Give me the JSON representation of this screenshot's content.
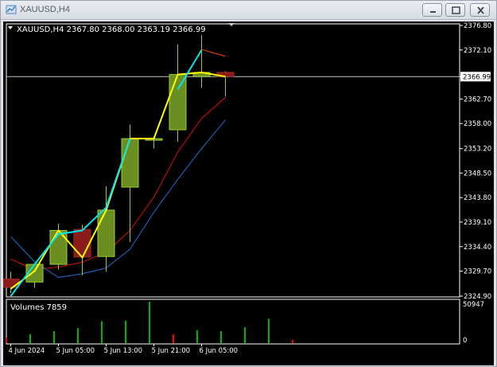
{
  "window": {
    "title": "XAUUSD,H4"
  },
  "chart_data": {
    "type": "candlestick",
    "symbol": "XAUUSD",
    "timeframe": "H4",
    "header": "XAUUSD,H4  2367.80 2368.00 2363.19 2366.99",
    "current_price": 2366.99,
    "current_price_label": "2366.99",
    "ylim": [
      2324.9,
      2376.8
    ],
    "price_ticks": [
      "2376.80",
      "2372.10",
      "2366.99",
      "2362.70",
      "2358.00",
      "2353.20",
      "2348.50",
      "2343.80",
      "2339.10",
      "2334.40",
      "2329.70",
      "2324.90"
    ],
    "time_labels": [
      "4 Jun 2024",
      "5 Jun 05:00",
      "5 Jun 13:00",
      "5 Jun 21:00",
      "6 Jun 05:00"
    ],
    "time_label_indices": [
      0,
      2,
      4,
      6,
      8
    ],
    "candles": [
      {
        "o": 2328.2,
        "h": 2329.6,
        "l": 2325.5,
        "c": 2326.6
      },
      {
        "o": 2327.6,
        "h": 2330.8,
        "l": 2326.5,
        "c": 2331.0
      },
      {
        "o": 2331.0,
        "h": 2338.8,
        "l": 2330.0,
        "c": 2337.5
      },
      {
        "o": 2337.7,
        "h": 2338.6,
        "l": 2328.9,
        "c": 2332.4
      },
      {
        "o": 2332.5,
        "h": 2346.0,
        "l": 2329.6,
        "c": 2341.4
      },
      {
        "o": 2345.8,
        "h": 2357.8,
        "l": 2335.3,
        "c": 2355.1
      },
      {
        "o": 2355.0,
        "h": 2355.5,
        "l": 2353.2,
        "c": 2355.1
      },
      {
        "o": 2356.8,
        "h": 2373.2,
        "l": 2354.5,
        "c": 2367.4
      },
      {
        "o": 2367.0,
        "h": 2375.0,
        "l": 2364.8,
        "c": 2367.8
      },
      {
        "o": 2367.8,
        "h": 2368.0,
        "l": 2363.19,
        "c": 2366.99
      }
    ],
    "series": [
      {
        "color": "#ffff00",
        "values": [
          2326.3,
          2329.7,
          2337.5,
          2332.3,
          2341.4,
          2355.1,
          2355.1,
          2367.4,
          2367.8,
          2367.0
        ]
      },
      {
        "color": "#00e5ee",
        "values": [
          2324.9,
          2331.0,
          2336.8,
          2337.5,
          2341.9,
          2355.1,
          null,
          2364.5,
          2372.1,
          null
        ]
      },
      {
        "color": "#ff4500",
        "values": [
          null,
          null,
          null,
          null,
          null,
          null,
          null,
          null,
          2372.2,
          2370.9
        ]
      },
      {
        "color": "#e01010",
        "values": [
          2332.0,
          2330.0,
          2330.5,
          2331.4,
          2333.3,
          2337.5,
          2343.9,
          2352.5,
          2359.0,
          2363.0
        ]
      },
      {
        "color": "#1e6ed8",
        "values": [
          2336.3,
          2331.5,
          2328.5,
          2329.2,
          2330.3,
          2333.9,
          2341.0,
          2347.3,
          2353.2,
          2358.7
        ]
      }
    ],
    "volumes": {
      "label": "Volumes 7859",
      "max_label": "50947",
      "zero_label": "0",
      "max": 50947,
      "values": [
        7000,
        11200,
        14800,
        18500,
        27000,
        27800,
        50947,
        11000,
        16000,
        14700,
        19700,
        29900,
        4100
      ],
      "colors": [
        "#ff0000",
        "#00b400",
        "#00b400",
        "#00b400",
        "#00b400",
        "#00b400",
        "#00b400",
        "#ff0000",
        "#00b400",
        "#00b400",
        "#00b400",
        "#00b400",
        "#ff0000"
      ]
    },
    "colors": {
      "background": "#000000",
      "foreground": "#ffffff",
      "bull_body": "#6b8e23",
      "bear_body": "#8b1a1a",
      "wick": "#9acd32"
    }
  }
}
